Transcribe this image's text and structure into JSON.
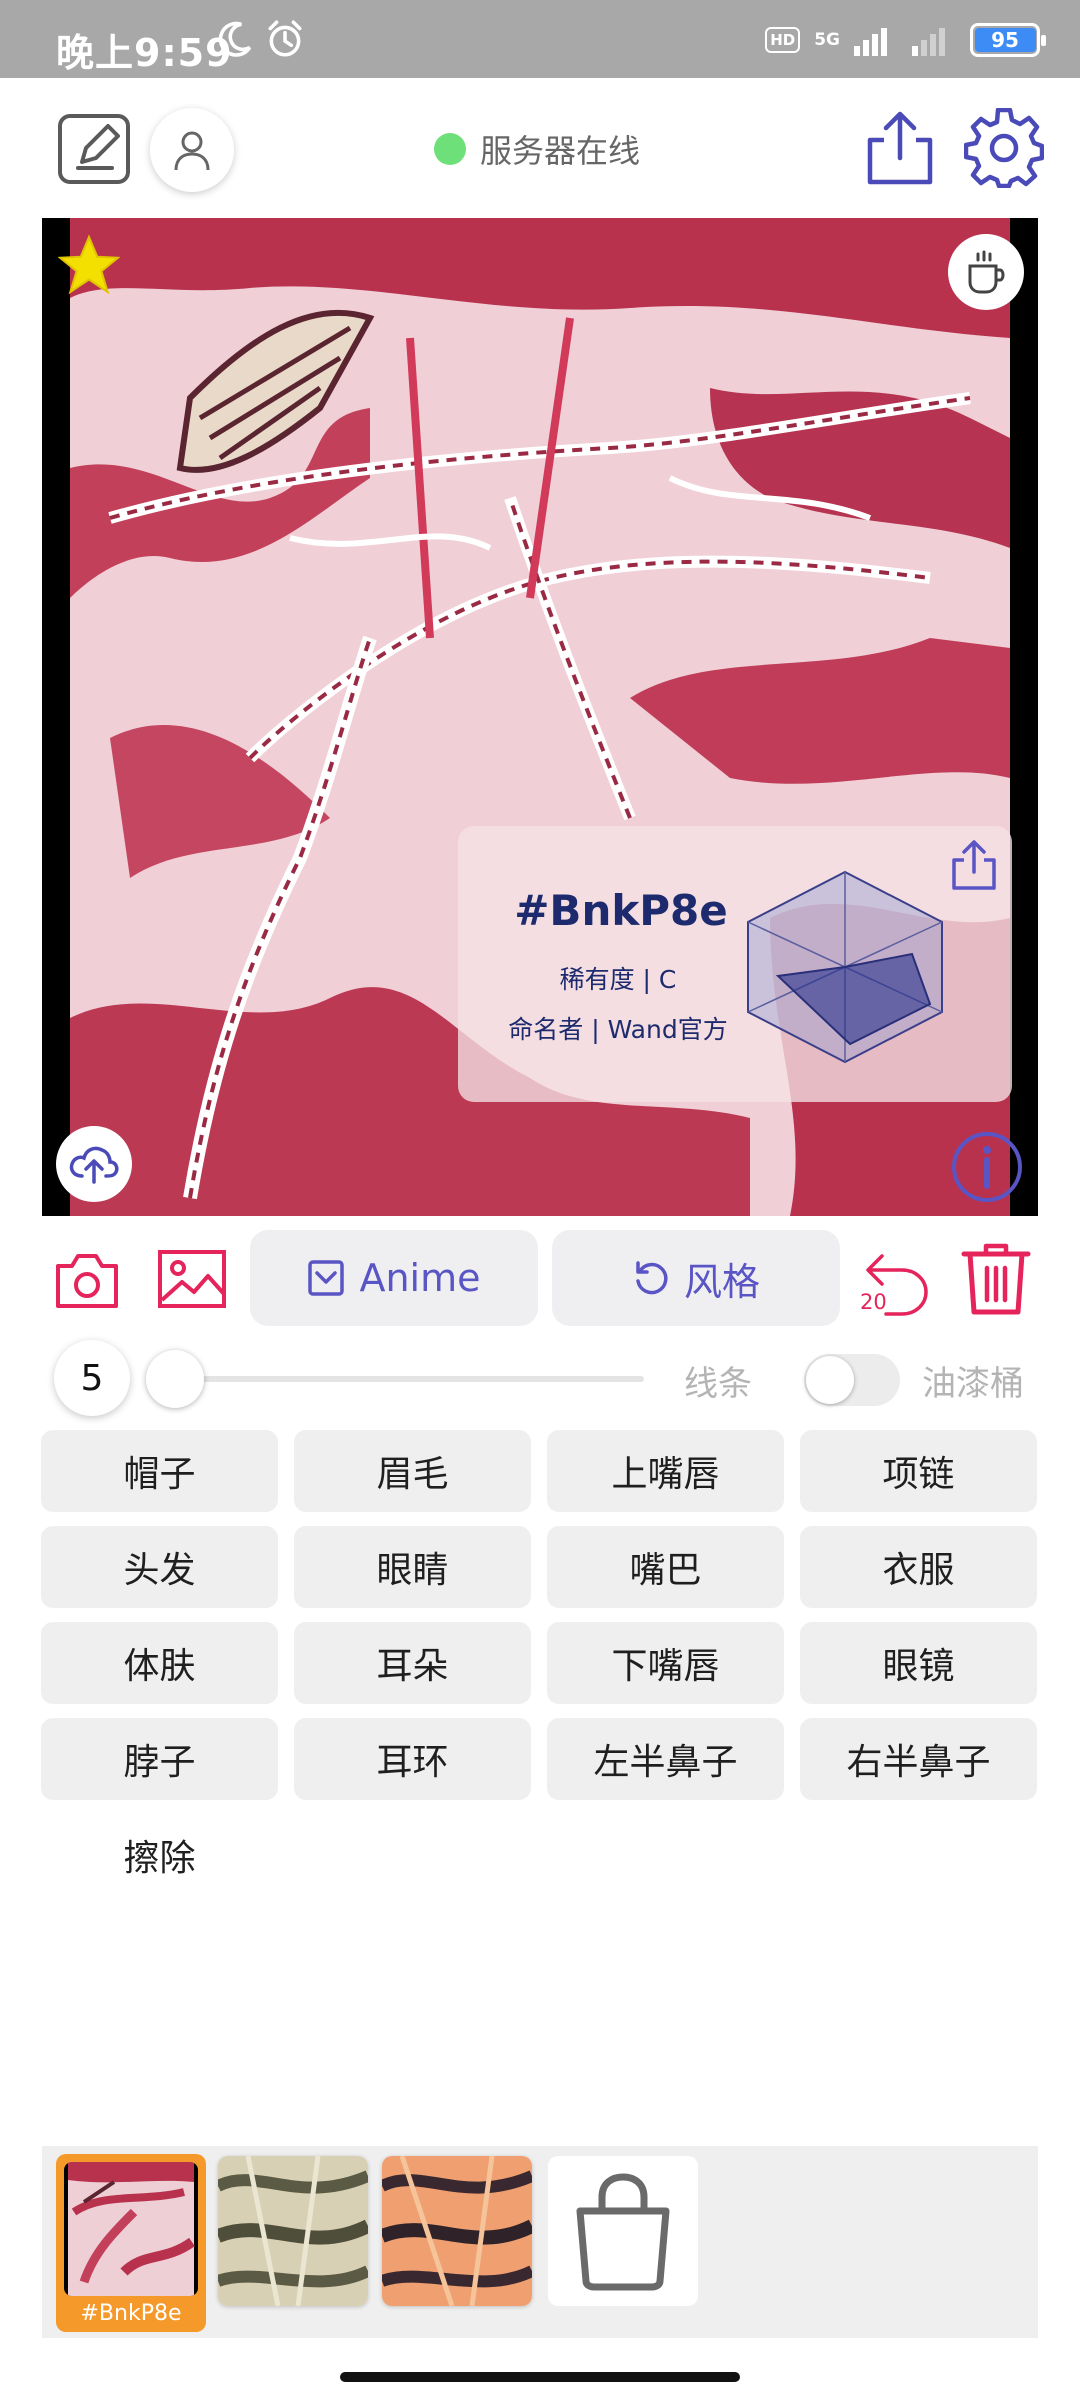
{
  "status_bar": {
    "time": "晚上9:59",
    "hd": "HD",
    "network": "5G",
    "battery": "95"
  },
  "header": {
    "server_status": "服务器在线",
    "server_status_color": "#6ee07a"
  },
  "canvas": {
    "code": "#BnkP8e",
    "rarity": "稀有度 | C",
    "namer": "命名者 | Wand官方"
  },
  "toolbar": {
    "anime_label": "Anime",
    "style_label": "风格",
    "undo_count": "20"
  },
  "brush": {
    "size": "5",
    "line_label": "线条",
    "bucket_label": "油漆桶"
  },
  "labels": [
    "帽子",
    "眉毛",
    "上嘴唇",
    "项链",
    "头发",
    "眼睛",
    "嘴巴",
    "衣服",
    "体肤",
    "耳朵",
    "下嘴唇",
    "眼镜",
    "脖子",
    "耳环",
    "左半鼻子",
    "右半鼻子",
    "擦除"
  ],
  "history": {
    "selected_caption": "#BnkP8e"
  },
  "colors": {
    "accent": "#5a55c4",
    "danger": "#e4245a",
    "selected": "#f59a2a"
  }
}
